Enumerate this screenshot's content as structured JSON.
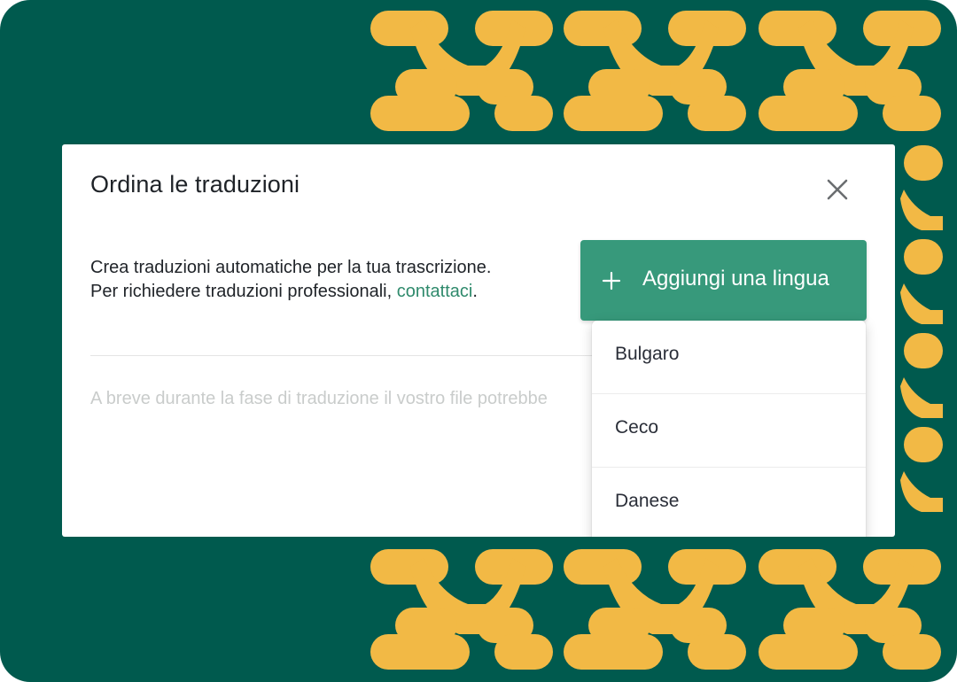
{
  "dialog": {
    "title": "Ordina le traduzioni",
    "description_line1": "Crea traduzioni automatiche per la tua trascrizione.",
    "description_line2_prefix": "Per richiedere traduzioni professionali, ",
    "contact_link": "contattaci",
    "description_line2_suffix": ".",
    "notice": "A breve durante la fase di traduzione il vostro file potrebbe",
    "close_icon": "close-icon"
  },
  "add_language_button": {
    "label": "Aggiungi una lingua",
    "icon": "plus-icon"
  },
  "language_dropdown": {
    "options": [
      "Bulgaro",
      "Ceco",
      "Danese"
    ]
  },
  "colors": {
    "background": "#005a4e",
    "pattern": "#f2b945",
    "accent": "#37997b",
    "link": "#2f8a6c"
  }
}
